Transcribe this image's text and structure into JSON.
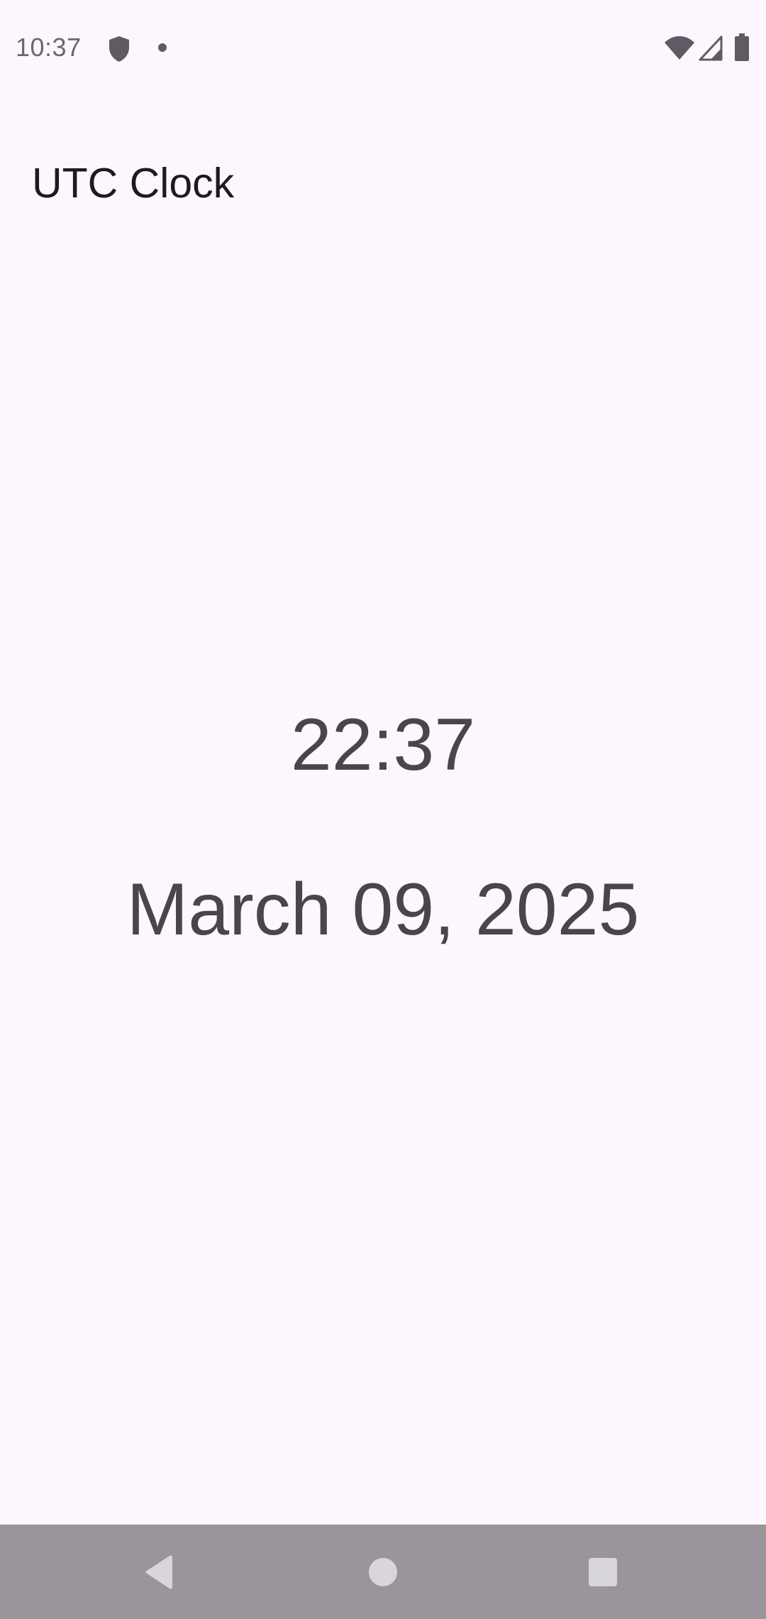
{
  "status_bar": {
    "time": "10:37",
    "icons": [
      "shield-icon",
      "dot-icon",
      "wifi-icon",
      "signal-icon",
      "battery-icon"
    ]
  },
  "app": {
    "title": "UTC Clock"
  },
  "clock": {
    "time": "22:37",
    "date": "March 09, 2025"
  },
  "nav_bar": {
    "buttons": [
      "back-icon",
      "home-icon",
      "recents-icon"
    ]
  },
  "colors": {
    "background": "#fdf7fd",
    "text_primary": "#1c1b1f",
    "text_secondary": "#49454f",
    "nav_bar": "#99959b",
    "nav_icon": "#d9d6db"
  }
}
